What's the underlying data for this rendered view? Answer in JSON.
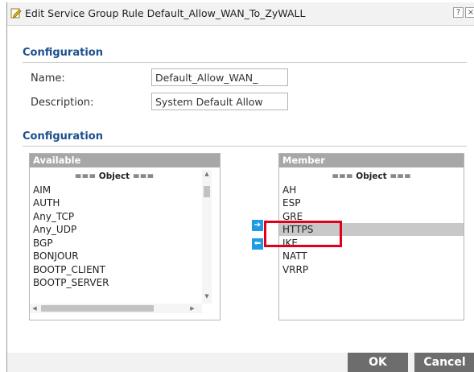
{
  "dialog": {
    "title": "Edit Service Group Rule Default_Allow_WAN_To_ZyWALL",
    "help_glyph": "?",
    "close_glyph": "×"
  },
  "section1": {
    "heading": "Configuration",
    "name_label": "Name:",
    "name_value": "Default_Allow_WAN_",
    "description_label": "Description:",
    "description_value": "System Default Allow"
  },
  "section2": {
    "heading": "Configuration",
    "available": {
      "header": "Available",
      "items": [
        {
          "label": "=== Object ===",
          "group": true
        },
        {
          "label": "AIM"
        },
        {
          "label": "AUTH"
        },
        {
          "label": "Any_TCP"
        },
        {
          "label": "Any_UDP"
        },
        {
          "label": "BGP"
        },
        {
          "label": "BONJOUR"
        },
        {
          "label": "BOOTP_CLIENT"
        },
        {
          "label": "BOOTP_SERVER"
        }
      ]
    },
    "member": {
      "header": "Member",
      "items": [
        {
          "label": "=== Object ===",
          "group": true
        },
        {
          "label": "AH"
        },
        {
          "label": "ESP"
        },
        {
          "label": "GRE"
        },
        {
          "label": "HTTPS",
          "selected": true
        },
        {
          "label": "IKE"
        },
        {
          "label": "NATT"
        },
        {
          "label": "VRRP"
        }
      ]
    },
    "move_right_glyph": "➔",
    "move_left_glyph": "⬅"
  },
  "footer": {
    "ok_label": "OK",
    "cancel_label": "Cancel"
  },
  "colors": {
    "accent": "#1e9ce3",
    "section_heading": "#1b4f8e",
    "highlight": "#e0001b",
    "button_bg": "#6d6d6d"
  }
}
